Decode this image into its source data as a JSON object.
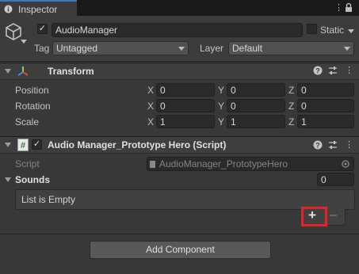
{
  "tab": {
    "label": "Inspector"
  },
  "gameobject": {
    "name": "AudioManager",
    "static_label": "Static",
    "tag_label": "Tag",
    "tag_value": "Untagged",
    "layer_label": "Layer",
    "layer_value": "Default"
  },
  "transform": {
    "title": "Transform",
    "rows": [
      {
        "label": "Position",
        "x": "0",
        "y": "0",
        "z": "0"
      },
      {
        "label": "Rotation",
        "x": "0",
        "y": "0",
        "z": "0"
      },
      {
        "label": "Scale",
        "x": "1",
        "y": "1",
        "z": "1"
      }
    ],
    "axis_x": "X",
    "axis_y": "Y",
    "axis_z": "Z"
  },
  "script_component": {
    "title": "Audio Manager_Prototype Hero (Script)",
    "script_label": "Script",
    "script_value": "AudioManager_PrototypeHero",
    "sounds_label": "Sounds",
    "sounds_count": "0",
    "list_empty_text": "List is Empty",
    "add_label": "+",
    "remove_label": "–"
  },
  "add_component": {
    "label": "Add Component"
  },
  "icons": {
    "tab": "info-icon",
    "menu": "kebab-menu-icon",
    "lock": "lock-icon",
    "help": "help-icon",
    "preset": "preset-sliders-icon",
    "gameobject": "cube-icon",
    "transform": "transform-axes-icon",
    "script": "script-hash-icon",
    "object_picker": "object-picker-icon"
  },
  "colors": {
    "highlight": "#e2232a",
    "tab_accent": "#3a79bb"
  }
}
